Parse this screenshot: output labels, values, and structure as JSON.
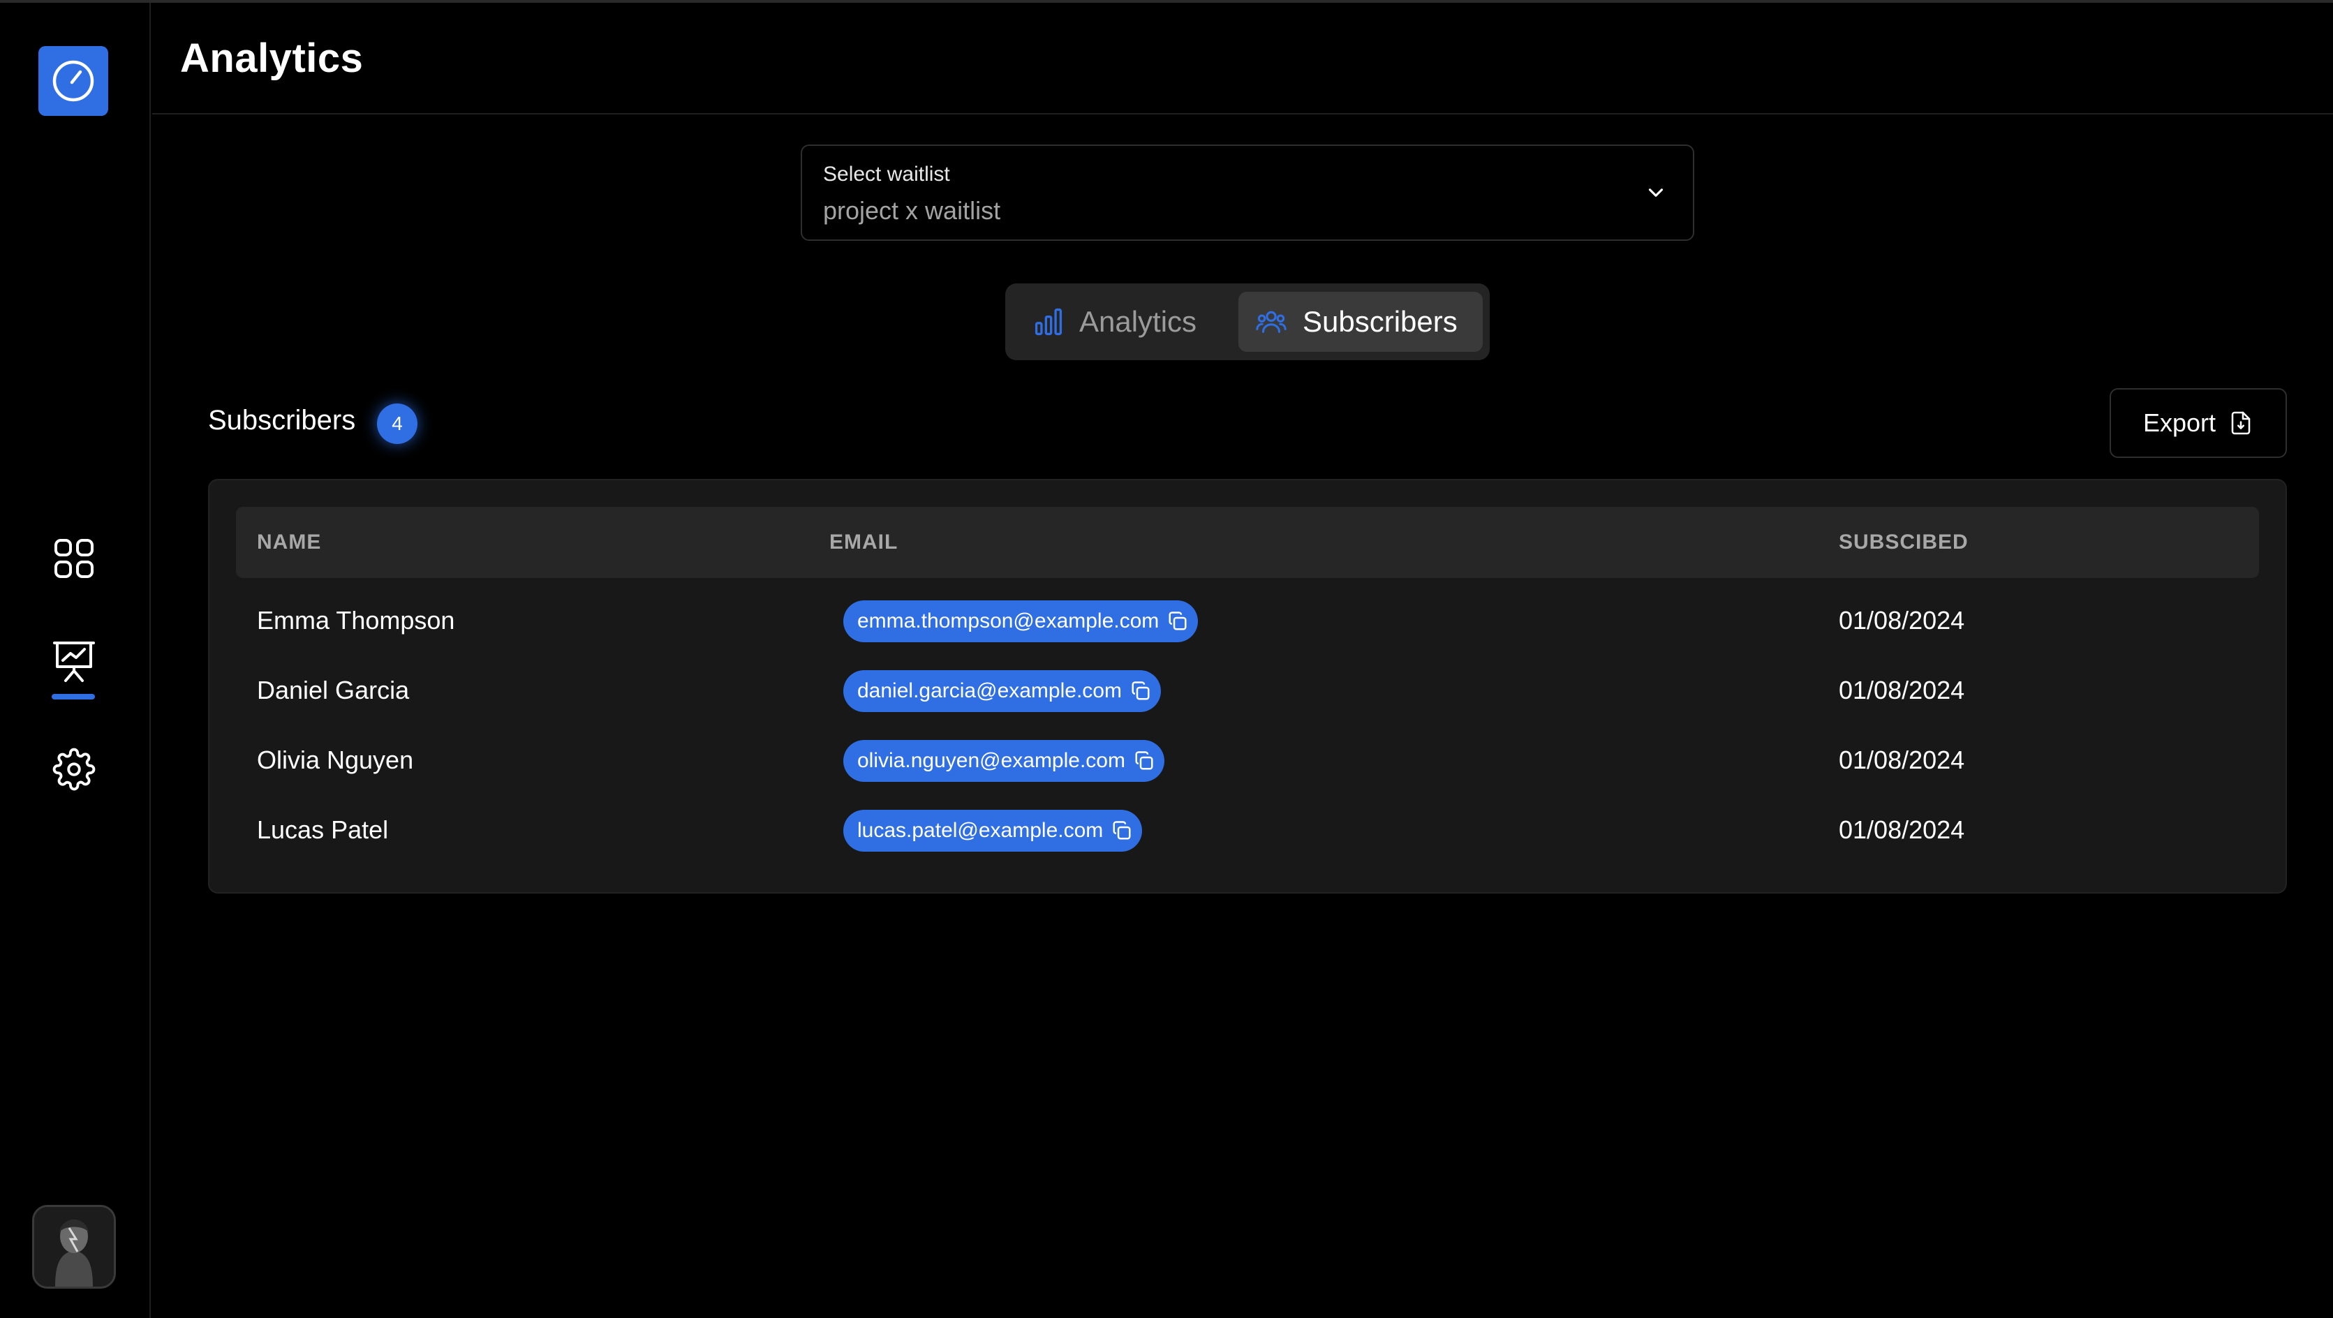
{
  "header": {
    "title": "Analytics"
  },
  "sidebar": {
    "logo": "gauge-logo-icon",
    "items": [
      {
        "name": "apps",
        "icon": "grid-icon",
        "active": false
      },
      {
        "name": "analytics",
        "icon": "presentation-chart-icon",
        "active": true
      },
      {
        "name": "settings",
        "icon": "gear-icon",
        "active": false
      }
    ],
    "avatar": "user-avatar"
  },
  "waitlist_select": {
    "label": "Select waitlist",
    "value": "project x waitlist"
  },
  "tabs": [
    {
      "label": "Analytics",
      "icon": "bar-chart-icon",
      "active": false
    },
    {
      "label": "Subscribers",
      "icon": "users-icon",
      "active": true
    }
  ],
  "subscribers": {
    "title": "Subscribers",
    "count": "4",
    "export_label": "Export",
    "columns": {
      "name": "NAME",
      "email": "EMAIL",
      "subscribed": "SUBSCIBED"
    },
    "rows": [
      {
        "name": "Emma Thompson",
        "email": "emma.thompson@example.com",
        "date": "01/08/2024"
      },
      {
        "name": "Daniel Garcia",
        "email": "daniel.garcia@example.com",
        "date": "01/08/2024"
      },
      {
        "name": "Olivia Nguyen",
        "email": "olivia.nguyen@example.com",
        "date": "01/08/2024"
      },
      {
        "name": "Lucas Patel",
        "email": "lucas.patel@example.com",
        "date": "01/08/2024"
      }
    ]
  },
  "colors": {
    "accent": "#2f6fe3",
    "background": "#000000",
    "card": "#181818",
    "table_header": "#262626",
    "muted_text": "#a3a3a3"
  }
}
